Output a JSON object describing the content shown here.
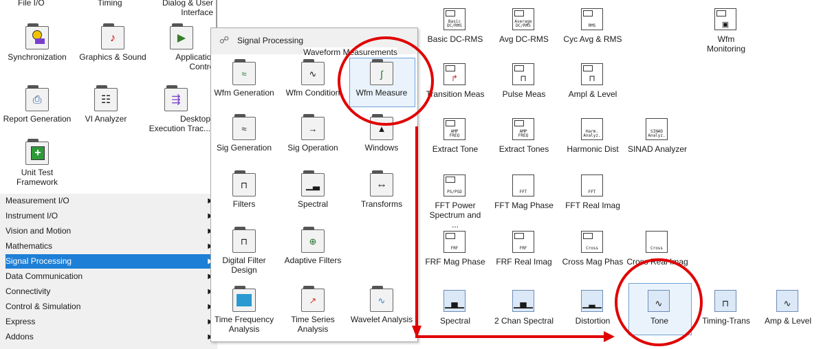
{
  "left_palette": {
    "top_labels": [
      "File I/O",
      "Timing",
      "Dialog & User Interface"
    ],
    "items": [
      {
        "label": "Synchronization",
        "icon": "synchronization-icon"
      },
      {
        "label": "Graphics & Sound",
        "icon": "graphics-sound-icon"
      },
      {
        "label": "Application Control",
        "icon": "application-control-icon"
      },
      {
        "label": "Report Generation",
        "icon": "report-generation-icon"
      },
      {
        "label": "VI Analyzer",
        "icon": "vi-analyzer-icon"
      },
      {
        "label": "Desktop Execution Trac...",
        "icon": "desktop-execution-icon"
      },
      {
        "label": "Unit Test Framework",
        "icon": "unit-test-icon"
      }
    ]
  },
  "categories": [
    {
      "label": "Measurement I/O"
    },
    {
      "label": "Instrument I/O"
    },
    {
      "label": "Vision and Motion"
    },
    {
      "label": "Mathematics"
    },
    {
      "label": "Signal Processing",
      "selected": true
    },
    {
      "label": "Data Communication"
    },
    {
      "label": "Connectivity"
    },
    {
      "label": "Control & Simulation"
    },
    {
      "label": "Express"
    },
    {
      "label": "Addons"
    }
  ],
  "signal_palette": {
    "title": "Signal Processing",
    "tooltip": "Waveform Measurements",
    "items": [
      {
        "label": "Wfm Generation"
      },
      {
        "label": "Wfm Condition"
      },
      {
        "label": "Wfm Measure"
      },
      {
        "label": "Sig Generation"
      },
      {
        "label": "Sig Operation"
      },
      {
        "label": "Windows"
      },
      {
        "label": "Filters"
      },
      {
        "label": "Spectral"
      },
      {
        "label": "Transforms"
      },
      {
        "label": "Digital Filter Design"
      },
      {
        "label": "Adaptive Filters"
      },
      {
        "label": "Time Frequency Analysis"
      },
      {
        "label": "Time Series Analysis"
      },
      {
        "label": "Wavelet Analysis"
      }
    ]
  },
  "wfm_measure_palette": {
    "items": [
      {
        "label": "Basic DC-RMS",
        "cap": "Basic DC/RMS"
      },
      {
        "label": "Avg DC-RMS",
        "cap": "Average DC/RMS"
      },
      {
        "label": "Cyc Avg & RMS",
        "cap": "RMS"
      },
      {
        "label": "Wfm Monitoring",
        "cap": ""
      },
      {
        "label": "Transition Meas",
        "cap": ""
      },
      {
        "label": "Pulse Meas",
        "cap": ""
      },
      {
        "label": "Ampl & Level",
        "cap": ""
      },
      {
        "label": "Extract Tone",
        "cap": "AMP FREQ"
      },
      {
        "label": "Extract Tones",
        "cap": "AMP FREQ"
      },
      {
        "label": "Harmonic Dist",
        "cap": "Harm. Analyz."
      },
      {
        "label": "SINAD Analyzer",
        "cap": "SINAD Analyz."
      },
      {
        "label": "FFT Power Spectrum and ...",
        "cap": "PS/PSD"
      },
      {
        "label": "FFT Mag Phase",
        "cap": "FFT"
      },
      {
        "label": "FFT Real Imag",
        "cap": "FFT"
      },
      {
        "label": "FRF Mag Phase",
        "cap": "FRF"
      },
      {
        "label": "FRF Real Imag",
        "cap": "FRF"
      },
      {
        "label": "Cross Mag Phas",
        "cap": "Cross"
      },
      {
        "label": "Cross Real Imag",
        "cap": "Cross"
      },
      {
        "label": "Spectral",
        "cap": ""
      },
      {
        "label": "2 Chan Spectral",
        "cap": ""
      },
      {
        "label": "Distortion",
        "cap": ""
      },
      {
        "label": "Tone",
        "cap": ""
      },
      {
        "label": "Timing-Trans",
        "cap": ""
      },
      {
        "label": "Amp & Level",
        "cap": ""
      }
    ]
  },
  "colors": {
    "annotation": "#e00000",
    "selection": "#1e7fd6"
  }
}
